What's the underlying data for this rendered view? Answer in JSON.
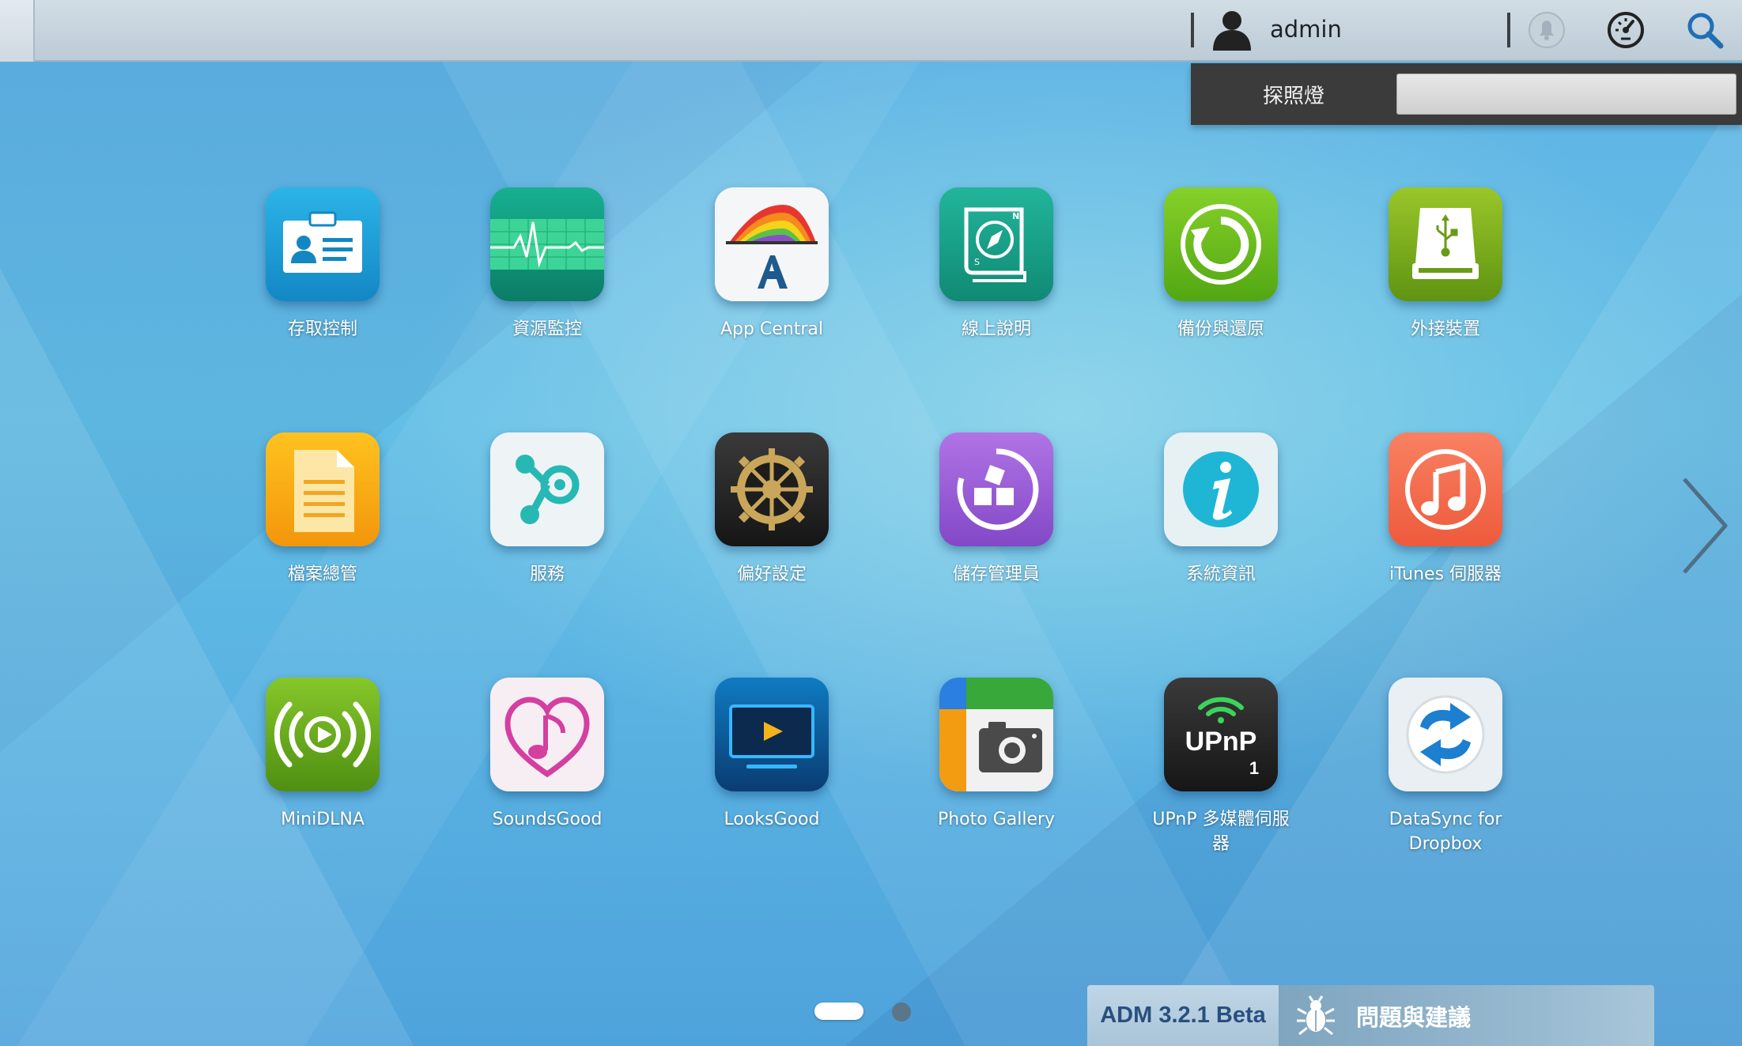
{
  "topbar": {
    "username": "admin",
    "icons": [
      "user-icon",
      "notification-icon",
      "dashboard-icon",
      "search-icon"
    ]
  },
  "spotlight": {
    "label": "探照燈",
    "input_value": ""
  },
  "apps": [
    {
      "label": "存取控制",
      "icon": "access-control-icon"
    },
    {
      "label": "資源監控",
      "icon": "resource-monitor-icon"
    },
    {
      "label": "App Central",
      "icon": "app-central-icon"
    },
    {
      "label": "線上說明",
      "icon": "online-help-icon"
    },
    {
      "label": "備份與還原",
      "icon": "backup-restore-icon"
    },
    {
      "label": "外接裝置",
      "icon": "external-device-icon"
    },
    {
      "label": "檔案總管",
      "icon": "file-explorer-icon"
    },
    {
      "label": "服務",
      "icon": "services-icon"
    },
    {
      "label": "偏好設定",
      "icon": "settings-gear-icon"
    },
    {
      "label": "儲存管理員",
      "icon": "storage-manager-icon"
    },
    {
      "label": "系統資訊",
      "icon": "system-info-icon"
    },
    {
      "label": "iTunes 伺服器",
      "icon": "itunes-server-icon"
    },
    {
      "label": "MiniDLNA",
      "icon": "minidlna-icon"
    },
    {
      "label": "SoundsGood",
      "icon": "soundsgood-icon"
    },
    {
      "label": "LooksGood",
      "icon": "looksgood-icon"
    },
    {
      "label": "Photo Gallery",
      "icon": "photo-gallery-icon"
    },
    {
      "label": "UPnP 多媒體伺服器",
      "icon": "upnp-icon"
    },
    {
      "label": "DataSync for Dropbox",
      "icon": "datasync-dropbox-icon"
    }
  ],
  "upnp_text": "UPnP",
  "upnp_badge": "1",
  "pagination": {
    "pages": 2,
    "current": 1
  },
  "bottombar": {
    "version": "ADM 3.2.1 Beta",
    "feedback_label": "問題與建議"
  },
  "colors": {
    "access_control": "#1b9fd6",
    "resource_monitor": "#0f9b80",
    "online_help": "#1aa38c",
    "backup": "#6bbf1c",
    "external": "#7fb01c",
    "file_explorer": "#f5a90f",
    "storage_manager": "#9b5bd6",
    "itunes": "#f26d4f",
    "minidlna": "#6fae1d"
  }
}
